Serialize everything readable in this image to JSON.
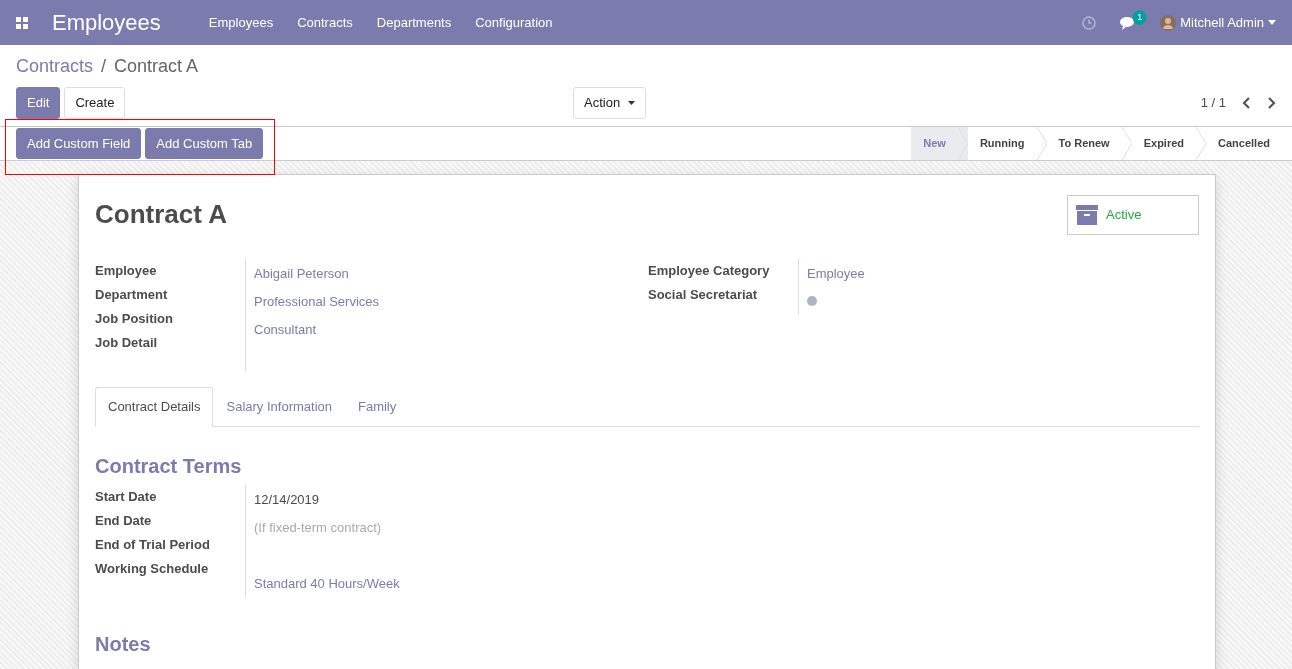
{
  "navbar": {
    "app_title": "Employees",
    "menu": [
      "Employees",
      "Contracts",
      "Departments",
      "Configuration"
    ],
    "chat_count": "1",
    "user": "Mitchell Admin"
  },
  "breadcrumb": [
    "Contracts",
    "Contract A"
  ],
  "breadcrumb_separator": "/",
  "buttons": [
    {
      "label": "Edit",
      "kind": "primary"
    },
    {
      "label": "Create",
      "kind": "secondary"
    }
  ],
  "action_menu": "Action",
  "pager": "1 / 1",
  "custom_buttons": [
    "Add Custom Field",
    "Add Custom Tab"
  ],
  "stages": [
    {
      "label": "New",
      "selected": true
    },
    {
      "label": "Running",
      "selected": false
    },
    {
      "label": "To Renew",
      "selected": false
    },
    {
      "label": "Expired",
      "selected": false
    },
    {
      "label": "Cancelled",
      "selected": false
    }
  ],
  "record": {
    "title": "Contract A",
    "active_label": "Active",
    "left_fields": [
      {
        "label": "Employee",
        "kind": "link",
        "value": "Abigail Peterson"
      },
      {
        "label": "Department",
        "kind": "link",
        "value": "Professional Services"
      },
      {
        "label": "Job Position",
        "kind": "link",
        "value": "Consultant"
      },
      {
        "label": "Job Detail",
        "kind": "empty"
      }
    ],
    "right_fields": [
      {
        "label": "Employee Category",
        "kind": "link",
        "value": "Employee"
      },
      {
        "label": "Social Secretariat",
        "kind": "dot"
      }
    ],
    "tabs": [
      {
        "label": "Contract Details",
        "selected": true
      },
      {
        "label": "Salary Information",
        "selected": false
      },
      {
        "label": "Family",
        "selected": false
      }
    ],
    "section_title": "Contract Terms",
    "terms": [
      {
        "label": "Start Date",
        "kind": "text",
        "value": "12/14/2019"
      },
      {
        "label": "End Date",
        "kind": "placeholder",
        "placeholder": "(If fixed-term contract)"
      },
      {
        "label": "End of Trial Period",
        "kind": "empty"
      },
      {
        "label": "Working Schedule",
        "kind": "link",
        "value": "Standard 40 Hours/Week"
      }
    ],
    "notes_title": "Notes"
  }
}
